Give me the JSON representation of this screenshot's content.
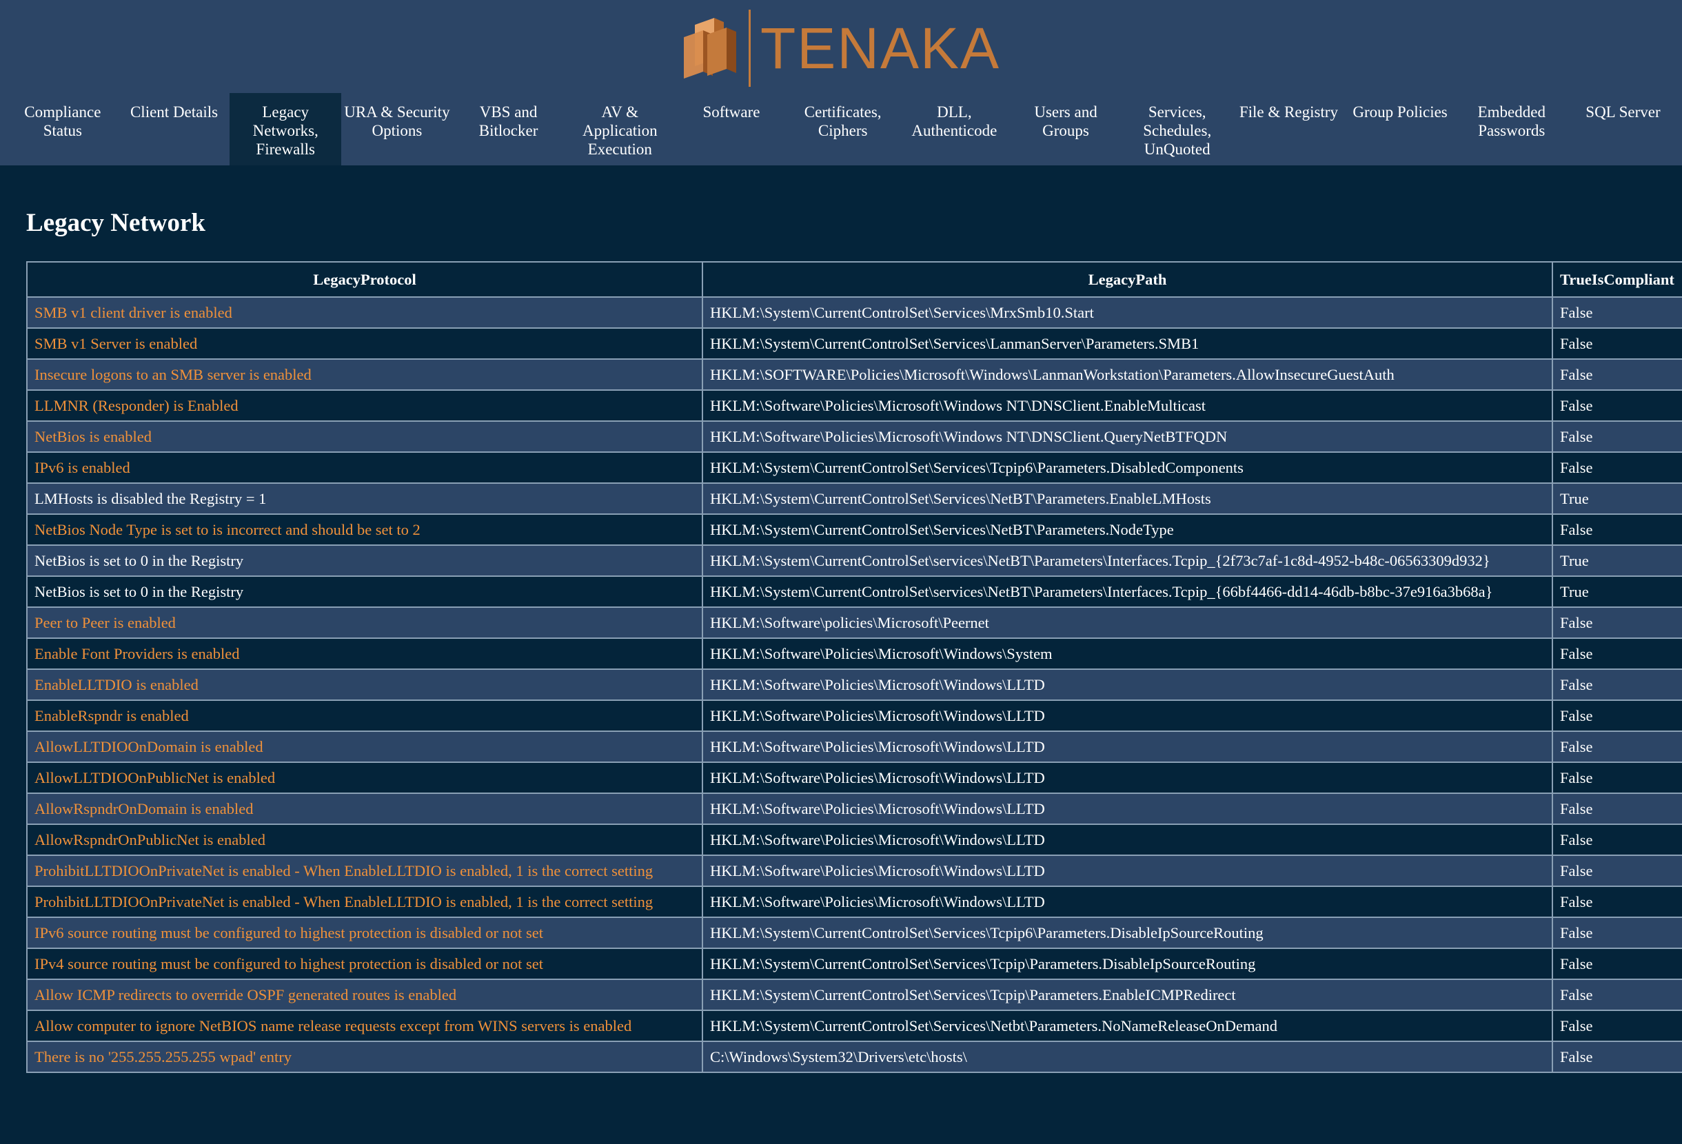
{
  "brand": {
    "name": "TENAKA",
    "logo_icon": "stacked-boxes-icon",
    "accent": "#c57a3a"
  },
  "nav": [
    {
      "label": "Compliance Status",
      "active": false
    },
    {
      "label": "Client Details",
      "active": false
    },
    {
      "label": "Legacy Networks, Firewalls",
      "active": true
    },
    {
      "label": "URA & Security Options",
      "active": false
    },
    {
      "label": "VBS and Bitlocker",
      "active": false
    },
    {
      "label": "AV & Application Execution",
      "active": false
    },
    {
      "label": "Software",
      "active": false
    },
    {
      "label": "Certificates, Ciphers",
      "active": false
    },
    {
      "label": "DLL, Authenticode",
      "active": false
    },
    {
      "label": "Users and Groups",
      "active": false
    },
    {
      "label": "Services, Schedules, UnQuoted",
      "active": false
    },
    {
      "label": "File & Registry",
      "active": false
    },
    {
      "label": "Group Policies",
      "active": false
    },
    {
      "label": "Embedded Passwords",
      "active": false
    },
    {
      "label": "SQL Server",
      "active": false
    }
  ],
  "section": {
    "title": "Legacy Network"
  },
  "table": {
    "columns": [
      "LegacyProtocol",
      "LegacyPath",
      "TrueIsCompliant"
    ],
    "rows": [
      {
        "protocol": "SMB v1 client driver is enabled",
        "path": "HKLM:\\System\\CurrentControlSet\\Services\\MrxSmb10.Start",
        "compliant": "False"
      },
      {
        "protocol": "SMB v1 Server is enabled",
        "path": "HKLM:\\System\\CurrentControlSet\\Services\\LanmanServer\\Parameters.SMB1",
        "compliant": "False"
      },
      {
        "protocol": "Insecure logons to an SMB server is enabled",
        "path": "HKLM:\\SOFTWARE\\Policies\\Microsoft\\Windows\\LanmanWorkstation\\Parameters.AllowInsecureGuestAuth",
        "compliant": "False"
      },
      {
        "protocol": "LLMNR (Responder) is Enabled",
        "path": "HKLM:\\Software\\Policies\\Microsoft\\Windows NT\\DNSClient.EnableMulticast",
        "compliant": "False"
      },
      {
        "protocol": "NetBios is enabled",
        "path": "HKLM:\\Software\\Policies\\Microsoft\\Windows NT\\DNSClient.QueryNetBTFQDN",
        "compliant": "False"
      },
      {
        "protocol": "IPv6 is enabled",
        "path": "HKLM:\\System\\CurrentControlSet\\Services\\Tcpip6\\Parameters.DisabledComponents",
        "compliant": "False"
      },
      {
        "protocol": "LMHosts is disabled the Registry = 1",
        "path": "HKLM:\\System\\CurrentControlSet\\Services\\NetBT\\Parameters.EnableLMHosts",
        "compliant": "True"
      },
      {
        "protocol": "NetBios Node Type is set to is incorrect and should be set to 2",
        "path": "HKLM:\\System\\CurrentControlSet\\Services\\NetBT\\Parameters.NodeType",
        "compliant": "False"
      },
      {
        "protocol": "NetBios is set to 0 in the Registry",
        "path": "HKLM:\\System\\CurrentControlSet\\services\\NetBT\\Parameters\\Interfaces.Tcpip_{2f73c7af-1c8d-4952-b48c-06563309d932}",
        "compliant": "True"
      },
      {
        "protocol": "NetBios is set to 0 in the Registry",
        "path": "HKLM:\\System\\CurrentControlSet\\services\\NetBT\\Parameters\\Interfaces.Tcpip_{66bf4466-dd14-46db-b8bc-37e916a3b68a}",
        "compliant": "True"
      },
      {
        "protocol": "Peer to Peer is enabled",
        "path": "HKLM:\\Software\\policies\\Microsoft\\Peernet",
        "compliant": "False"
      },
      {
        "protocol": "Enable Font Providers is enabled",
        "path": "HKLM:\\Software\\Policies\\Microsoft\\Windows\\System",
        "compliant": "False"
      },
      {
        "protocol": "EnableLLTDIO is enabled",
        "path": "HKLM:\\Software\\Policies\\Microsoft\\Windows\\LLTD",
        "compliant": "False"
      },
      {
        "protocol": "EnableRspndr is enabled",
        "path": "HKLM:\\Software\\Policies\\Microsoft\\Windows\\LLTD",
        "compliant": "False"
      },
      {
        "protocol": "AllowLLTDIOOnDomain is enabled",
        "path": "HKLM:\\Software\\Policies\\Microsoft\\Windows\\LLTD",
        "compliant": "False"
      },
      {
        "protocol": "AllowLLTDIOOnPublicNet is enabled",
        "path": "HKLM:\\Software\\Policies\\Microsoft\\Windows\\LLTD",
        "compliant": "False"
      },
      {
        "protocol": "AllowRspndrOnDomain is enabled",
        "path": "HKLM:\\Software\\Policies\\Microsoft\\Windows\\LLTD",
        "compliant": "False"
      },
      {
        "protocol": "AllowRspndrOnPublicNet is enabled",
        "path": "HKLM:\\Software\\Policies\\Microsoft\\Windows\\LLTD",
        "compliant": "False"
      },
      {
        "protocol": "ProhibitLLTDIOOnPrivateNet is enabled - When EnableLLTDIO is enabled, 1 is the correct setting",
        "path": "HKLM:\\Software\\Policies\\Microsoft\\Windows\\LLTD",
        "compliant": "False"
      },
      {
        "protocol": "ProhibitLLTDIOOnPrivateNet is enabled - When EnableLLTDIO is enabled, 1 is the correct setting",
        "path": "HKLM:\\Software\\Policies\\Microsoft\\Windows\\LLTD",
        "compliant": "False"
      },
      {
        "protocol": "IPv6 source routing must be configured to highest protection is disabled or not set",
        "path": "HKLM:\\System\\CurrentControlSet\\Services\\Tcpip6\\Parameters.DisableIpSourceRouting",
        "compliant": "False"
      },
      {
        "protocol": "IPv4 source routing must be configured to highest protection is disabled or not set",
        "path": "HKLM:\\System\\CurrentControlSet\\Services\\Tcpip\\Parameters.DisableIpSourceRouting",
        "compliant": "False"
      },
      {
        "protocol": "Allow ICMP redirects to override OSPF generated routes is enabled",
        "path": "HKLM:\\System\\CurrentControlSet\\Services\\Tcpip\\Parameters.EnableICMPRedirect",
        "compliant": "False"
      },
      {
        "protocol": "Allow computer to ignore NetBIOS name release requests except from WINS servers is enabled",
        "path": "HKLM:\\System\\CurrentControlSet\\Services\\Netbt\\Parameters.NoNameReleaseOnDemand",
        "compliant": "False"
      },
      {
        "protocol": "There is no '255.255.255.255 wpad' entry",
        "path": "C:\\Windows\\System32\\Drivers\\etc\\hosts\\",
        "compliant": "False"
      }
    ]
  }
}
